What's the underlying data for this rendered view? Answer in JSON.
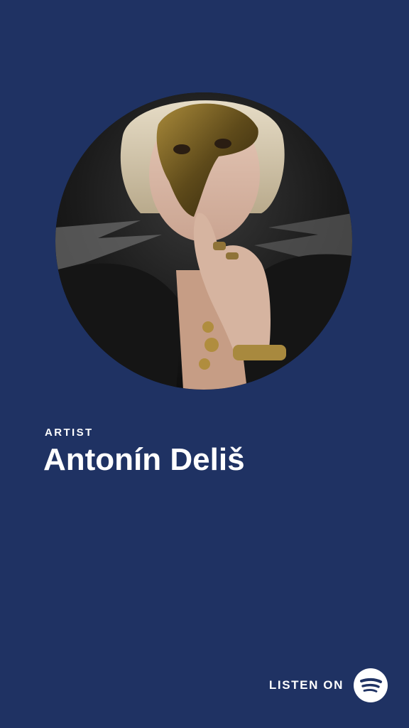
{
  "card": {
    "label": "ARTIST",
    "artist_name": "Antonín Deliš",
    "photo_icon": "artist-portrait"
  },
  "footer": {
    "listen_label": "LISTEN ON",
    "brand_icon": "spotify-icon"
  },
  "colors": {
    "background": "#1f3263",
    "text": "#ffffff",
    "brand_circle": "#ffffff",
    "brand_waves": "#1f3263"
  }
}
